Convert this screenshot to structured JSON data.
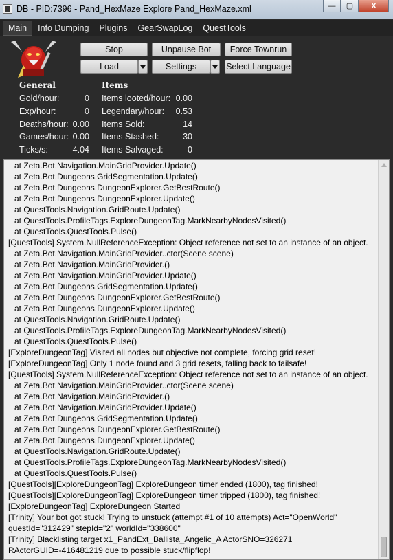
{
  "window": {
    "title": "DB - PID:7396 - Pand_HexMaze Explore Pand_HexMaze.xml",
    "minimize_glyph": "—",
    "maximize_glyph": "▢",
    "close_glyph": "X"
  },
  "menu": [
    "Main",
    "Info Dumping",
    "Plugins",
    "GearSwapLog",
    "QuestTools"
  ],
  "buttons": {
    "stop": "Stop",
    "unpause": "Unpause Bot",
    "force_townrun": "Force Townrun",
    "load": "Load",
    "settings": "Settings",
    "select_language": "Select Language"
  },
  "general": {
    "heading": "General",
    "rows": [
      {
        "label": "Gold/hour:",
        "value": "0"
      },
      {
        "label": "Exp/hour:",
        "value": "0"
      },
      {
        "label": "Deaths/hour:",
        "value": "0.00"
      },
      {
        "label": "Games/hour:",
        "value": "0.00"
      },
      {
        "label": "Ticks/s:",
        "value": "4.04"
      }
    ]
  },
  "items": {
    "heading": "Items",
    "rows": [
      {
        "label": "Items looted/hour:",
        "value": "0.00"
      },
      {
        "label": "Legendary/hour:",
        "value": "0.53"
      },
      {
        "label": "Items Sold:",
        "value": "14"
      },
      {
        "label": "Items Stashed:",
        "value": "30"
      },
      {
        "label": "Items Salvaged:",
        "value": "0"
      }
    ]
  },
  "log": [
    {
      "text": "at Zeta.Bot.Navigation.MainGridProvider.Update()",
      "indent": true
    },
    {
      "text": "at Zeta.Bot.Dungeons.GridSegmentation.Update()",
      "indent": true
    },
    {
      "text": "at Zeta.Bot.Dungeons.DungeonExplorer.GetBestRoute()",
      "indent": true
    },
    {
      "text": "at Zeta.Bot.Dungeons.DungeonExplorer.Update()",
      "indent": true
    },
    {
      "text": "at QuestTools.Navigation.GridRoute.Update()",
      "indent": true
    },
    {
      "text": "at QuestTools.ProfileTags.ExploreDungeonTag.MarkNearbyNodesVisited()",
      "indent": true
    },
    {
      "text": "at QuestTools.QuestTools.Pulse()",
      "indent": true
    },
    {
      "text": "[QuestTools] System.NullReferenceException: Object reference not set to an instance of an object.",
      "indent": false
    },
    {
      "text": "at Zeta.Bot.Navigation.MainGridProvider..ctor(Scene scene)",
      "indent": true
    },
    {
      "text": "at Zeta.Bot.Navigation.MainGridProvider.()",
      "indent": true
    },
    {
      "text": "at Zeta.Bot.Navigation.MainGridProvider.Update()",
      "indent": true
    },
    {
      "text": "at Zeta.Bot.Dungeons.GridSegmentation.Update()",
      "indent": true
    },
    {
      "text": "at Zeta.Bot.Dungeons.DungeonExplorer.GetBestRoute()",
      "indent": true
    },
    {
      "text": "at Zeta.Bot.Dungeons.DungeonExplorer.Update()",
      "indent": true
    },
    {
      "text": "at QuestTools.Navigation.GridRoute.Update()",
      "indent": true
    },
    {
      "text": "at QuestTools.ProfileTags.ExploreDungeonTag.MarkNearbyNodesVisited()",
      "indent": true
    },
    {
      "text": "at QuestTools.QuestTools.Pulse()",
      "indent": true
    },
    {
      "text": "[ExploreDungeonTag] Visited all nodes but objective not complete, forcing grid reset!",
      "indent": false
    },
    {
      "text": "[ExploreDungeonTag] Only 1 node found and 3 grid resets, falling back to failsafe!",
      "indent": false
    },
    {
      "text": "[QuestTools] System.NullReferenceException: Object reference not set to an instance of an object.",
      "indent": false
    },
    {
      "text": "at Zeta.Bot.Navigation.MainGridProvider..ctor(Scene scene)",
      "indent": true
    },
    {
      "text": "at Zeta.Bot.Navigation.MainGridProvider.()",
      "indent": true
    },
    {
      "text": "at Zeta.Bot.Navigation.MainGridProvider.Update()",
      "indent": true
    },
    {
      "text": "at Zeta.Bot.Dungeons.GridSegmentation.Update()",
      "indent": true
    },
    {
      "text": "at Zeta.Bot.Dungeons.DungeonExplorer.GetBestRoute()",
      "indent": true
    },
    {
      "text": "at Zeta.Bot.Dungeons.DungeonExplorer.Update()",
      "indent": true
    },
    {
      "text": "at QuestTools.Navigation.GridRoute.Update()",
      "indent": true
    },
    {
      "text": "at QuestTools.ProfileTags.ExploreDungeonTag.MarkNearbyNodesVisited()",
      "indent": true
    },
    {
      "text": "at QuestTools.QuestTools.Pulse()",
      "indent": true
    },
    {
      "text": "[QuestTools][ExploreDungeonTag] ExploreDungeon timer ended (1800), tag finished!",
      "indent": false
    },
    {
      "text": "[QuestTools][ExploreDungeonTag] ExploreDungeon timer tripped (1800), tag finished!",
      "indent": false
    },
    {
      "text": "[ExploreDungeonTag] ExploreDungeon Started",
      "indent": false
    },
    {
      "text": "[Trinity] Your bot got stuck! Trying to unstuck (attempt #1 of 10 attempts) Act=\"OpenWorld\"",
      "indent": false
    },
    {
      "text": "questId=\"312429\" stepId=\"2\" worldId=\"338600\"",
      "indent": false
    },
    {
      "text": "[Trinity] Blacklisting target x1_PandExt_Ballista_Angelic_A ActorSNO=326271",
      "indent": false
    },
    {
      "text": "RActorGUID=-416481219 due to possible stuck/flipflop!",
      "indent": false
    }
  ]
}
